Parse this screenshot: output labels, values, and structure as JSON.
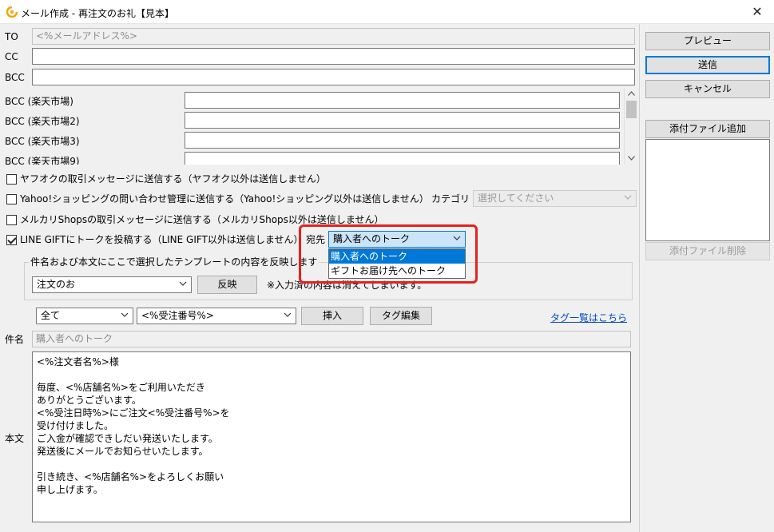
{
  "window": {
    "title": "メール作成 - 再注文のお礼【見本】"
  },
  "to": {
    "label": "TO",
    "value": "<%メールアドレス%>"
  },
  "cc": {
    "label": "CC",
    "value": ""
  },
  "bcc": {
    "label": "BCC",
    "value": ""
  },
  "bcc_list": [
    {
      "label": "BCC (楽天市場)",
      "value": ""
    },
    {
      "label": "BCC (楽天市場2)",
      "value": ""
    },
    {
      "label": "BCC (楽天市場3)",
      "value": ""
    },
    {
      "label": "BCC (楽天市場9)",
      "value": ""
    }
  ],
  "options": {
    "yahuoku": {
      "label": "ヤフオクの取引メッセージに送信する（ヤフオク以外は送信しません）",
      "checked": false
    },
    "yahoo_shopping": {
      "label": "Yahoo!ショッピングの問い合わせ管理に送信する（Yahoo!ショッピング以外は送信しません）",
      "checked": false,
      "category_label": "カテゴリ",
      "category_value": "選択してください"
    },
    "mercari": {
      "label": "メルカリShopsの取引メッセージに送信する（メルカリShops以外は送信しません）",
      "checked": false
    },
    "line_gift": {
      "label": "LINE GIFTにトークを投稿する（LINE GIFT以外は送信しません）",
      "checked": true,
      "dest_label": "宛先",
      "dest_value": "購入者へのトーク",
      "dest_options": [
        "購入者へのトーク",
        "ギフトお届け先へのトーク"
      ]
    }
  },
  "template": {
    "group_label": "件名および本文にここで選択したテンプレートの内容を反映します",
    "selected": "注文のお",
    "apply_label": "反映",
    "note": "※入力済の内容は消えてしまいます。"
  },
  "tags": {
    "filter_value": "全て",
    "tag_value": "<%受注番号%>",
    "insert_label": "挿入",
    "edit_label": "タグ編集",
    "list_link": "タグ一覧はこちら"
  },
  "subject": {
    "label": "件名",
    "value": "購入者へのトーク"
  },
  "body": {
    "label": "本文",
    "text": "<%注文者名%>様\n\n毎度、<%店舗名%>をご利用いただき\nありがとうございます。\n<%受注日時%>にご注文<%受注番号%>を\n受け付けました。\nご入金が確認できしだい発送いたします。\n発送後にメールでお知らせいたします。\n\n引き続き、<%店舗名%>をよろしくお願い\n申し上げます。"
  },
  "sidebar": {
    "preview_label": "プレビュー",
    "send_label": "送信",
    "cancel_label": "キャンセル",
    "attach_add_label": "添付ファイル追加",
    "attach_delete_label": "添付ファイル削除"
  },
  "colors": {
    "accent": "#0078d7",
    "highlight": "#e8201e",
    "link": "#0048c8"
  }
}
